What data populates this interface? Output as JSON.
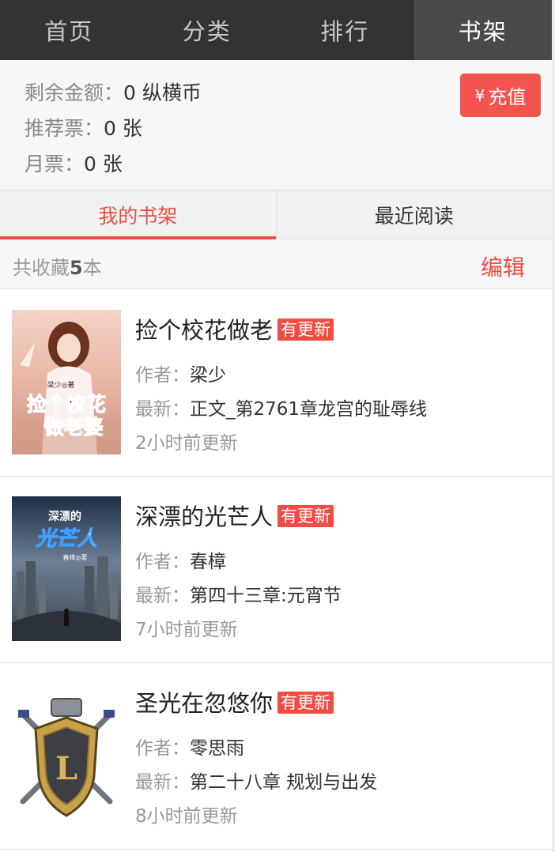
{
  "nav": {
    "items": [
      {
        "label": "首页"
      },
      {
        "label": "分类"
      },
      {
        "label": "排行"
      },
      {
        "label": "书架"
      }
    ],
    "active_index": 3
  },
  "account": {
    "balance_label": "剩余金额：",
    "balance_value": "0 纵横币",
    "recommend_label": "推荐票：",
    "recommend_value": "0 张",
    "monthly_label": "月票：",
    "monthly_value": "0 张",
    "recharge_symbol": "¥",
    "recharge_label": "充值"
  },
  "tabs": [
    {
      "label": "我的书架"
    },
    {
      "label": "最近阅读"
    }
  ],
  "summary": {
    "prefix": "共收藏",
    "count": "5",
    "suffix": "本",
    "edit_label": "编辑"
  },
  "books": [
    {
      "title": "捡个校花做老",
      "badge": "有更新",
      "author_label": "作者：",
      "author": "梁少",
      "latest_label": "最新：",
      "latest": "正文_第2761章龙宫的耻辱线",
      "updated": "2小时前更新",
      "cover_text_1": "捡个校花",
      "cover_text_2": "做老婆",
      "cover_author": "梁少◎著"
    },
    {
      "title": "深漂的光芒人",
      "badge": "有更新",
      "author_label": "作者：",
      "author": "春樟",
      "latest_label": "最新：",
      "latest": "第四十三章:元宵节",
      "updated": "7小时前更新",
      "cover_text_1": "深漂的",
      "cover_text_2": "光芒人",
      "cover_author": "春樟◎著"
    },
    {
      "title": "圣光在忽悠你",
      "badge": "有更新",
      "author_label": "作者：",
      "author": "零思雨",
      "latest_label": "最新：",
      "latest": "第二十八章 规划与出发",
      "updated": "8小时前更新"
    }
  ],
  "colors": {
    "accent": "#f04c43",
    "nav_bg": "#333333",
    "nav_active": "#4a4a4a"
  }
}
